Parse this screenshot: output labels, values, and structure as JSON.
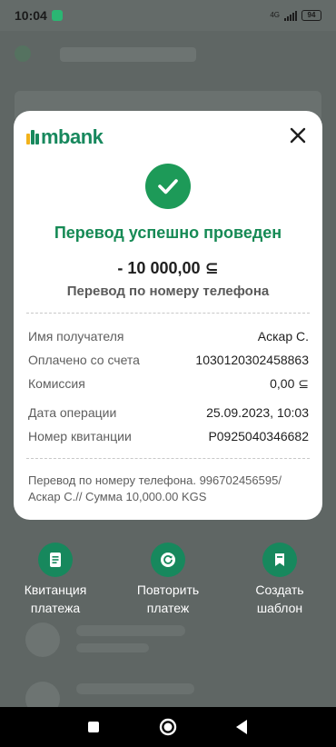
{
  "status_bar": {
    "time": "10:04",
    "network": "4G",
    "battery": "94"
  },
  "modal": {
    "brand": "mbank",
    "title": "Перевод успешно проведен",
    "amount": "- 10 000,00 ⊆",
    "subtitle": "Перевод по номеру телефона",
    "details": [
      {
        "label": "Имя получателя",
        "value": "Аскар С."
      },
      {
        "label": "Оплачено со счета",
        "value": "1030120302458863"
      },
      {
        "label": "Комиссия",
        "value": "0,00 ⊆"
      }
    ],
    "details2": [
      {
        "label": "Дата операции",
        "value": "25.09.2023, 10:03"
      },
      {
        "label": "Номер квитанции",
        "value": "P0925040346682"
      }
    ],
    "note": "Перевод по номеру телефона. 996702456595/ Аскар С.// Сумма 10,000.00 KGS"
  },
  "actions": [
    {
      "line1": "Квитанция",
      "line2": "платежа",
      "icon": "receipt-icon"
    },
    {
      "line1": "Повторить",
      "line2": "платеж",
      "icon": "repeat-icon"
    },
    {
      "line1": "Создать",
      "line2": "шаблон",
      "icon": "bookmark-icon"
    }
  ],
  "colors": {
    "brand_green": "#17885d",
    "success_green": "#1d9a58",
    "overlay": "#5f6664"
  }
}
